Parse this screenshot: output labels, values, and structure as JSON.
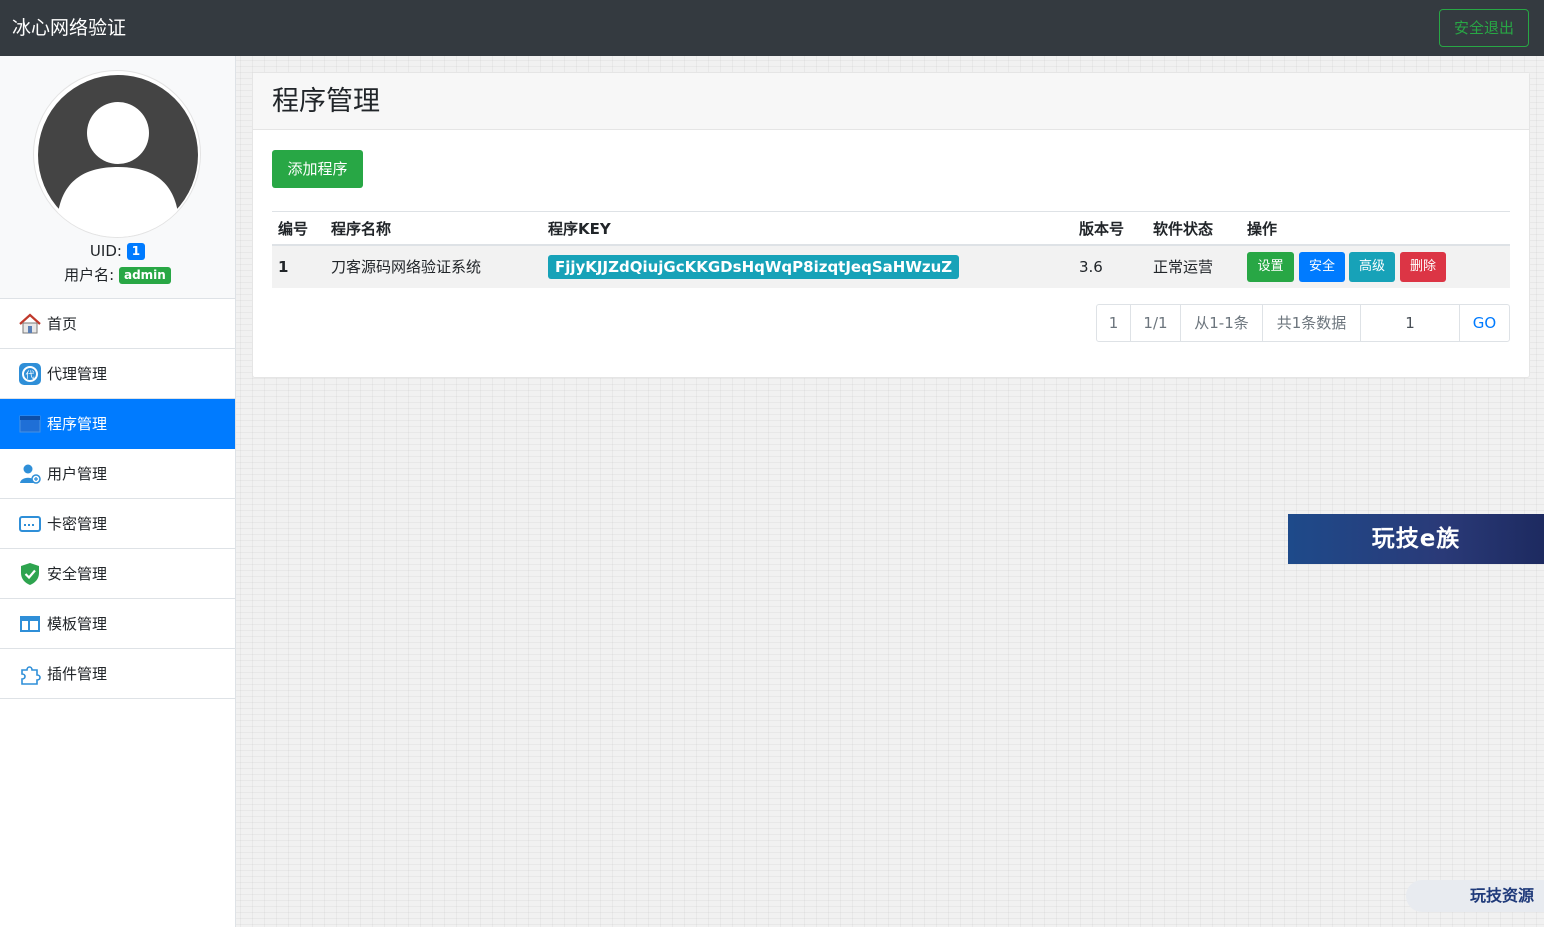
{
  "app": {
    "title": "冰心网络验证",
    "logout_label": "安全退出"
  },
  "profile": {
    "uid_label": "UID:",
    "uid": "1",
    "username_label": "用户名:",
    "username": "admin"
  },
  "sidebar": {
    "items": [
      {
        "label": "首页",
        "icon": "home-icon"
      },
      {
        "label": "代理管理",
        "icon": "agent-icon"
      },
      {
        "label": "程序管理",
        "icon": "program-icon",
        "active": true
      },
      {
        "label": "用户管理",
        "icon": "user-icon"
      },
      {
        "label": "卡密管理",
        "icon": "card-icon"
      },
      {
        "label": "安全管理",
        "icon": "shield-icon"
      },
      {
        "label": "模板管理",
        "icon": "template-icon"
      },
      {
        "label": "插件管理",
        "icon": "puzzle-icon"
      }
    ]
  },
  "main": {
    "title": "程序管理",
    "add_button": "添加程序",
    "table": {
      "headers": [
        "编号",
        "程序名称",
        "程序KEY",
        "版本号",
        "软件状态",
        "操作"
      ],
      "rows": [
        {
          "id": "1",
          "name": "刀客源码网络验证系统",
          "key": "FjjyKJJZdQiujGcKKGDsHqWqP8izqtJeqSaHWzuZ",
          "version": "3.6",
          "status": "正常运营",
          "actions": [
            "设置",
            "安全",
            "高级",
            "删除"
          ]
        }
      ]
    },
    "pagination": {
      "page": "1",
      "pages": "1/1",
      "range": "从1-1条",
      "total": "共1条数据",
      "input_value": "1",
      "go_label": "GO"
    }
  },
  "watermarks": {
    "banner": "玩技e族",
    "corner": "玩技资源"
  },
  "colors": {
    "navbar": "#343a40",
    "primary": "#007bff",
    "success": "#28a745",
    "info": "#17a2b8",
    "danger": "#dc3545"
  }
}
